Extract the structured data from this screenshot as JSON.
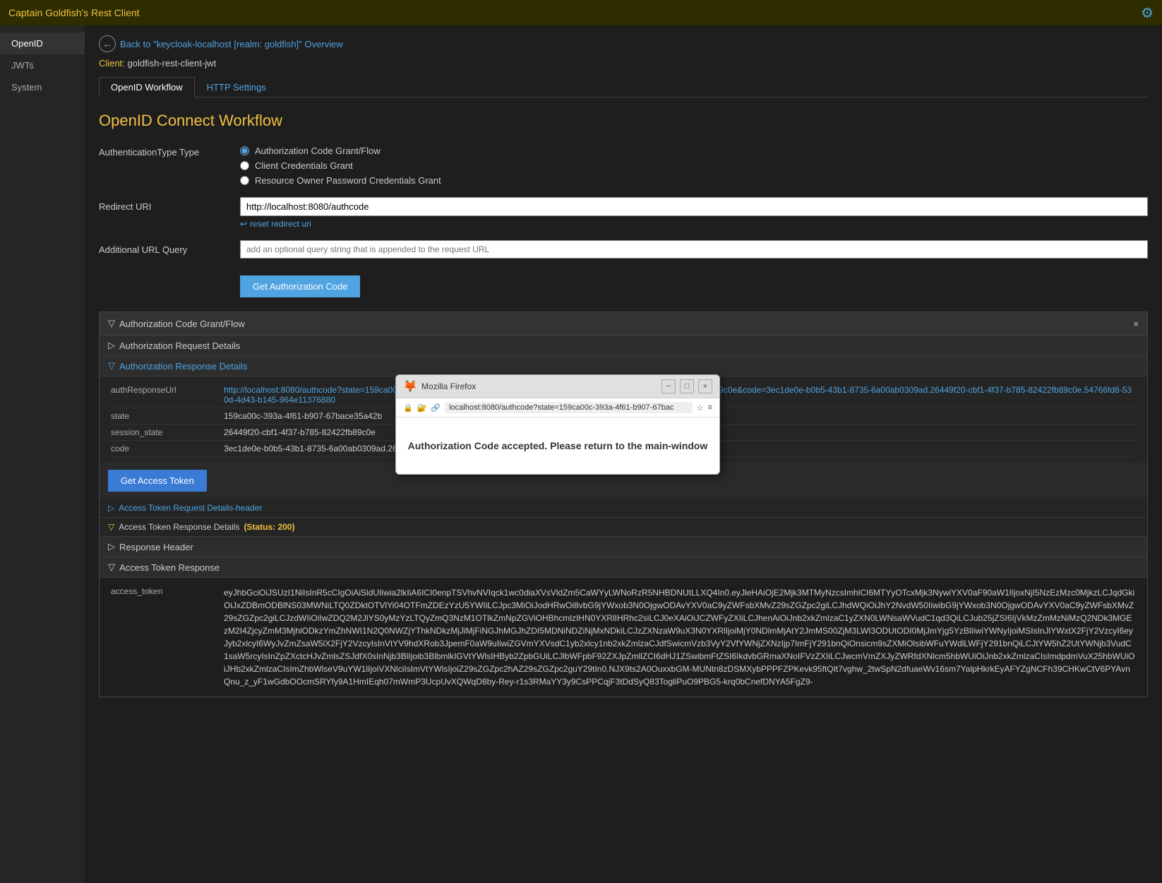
{
  "titlebar": {
    "title": "Captain Goldfish's Rest Client",
    "icon": "⚙"
  },
  "sidebar": {
    "items": [
      {
        "id": "openid",
        "label": "OpenID",
        "active": true
      },
      {
        "id": "jwts",
        "label": "JWTs",
        "active": false
      },
      {
        "id": "system",
        "label": "System",
        "active": false
      }
    ]
  },
  "header": {
    "back_text": "Back to \"keycloak-localhost [realm: goldfish]\" Overview",
    "client_label": "Client:",
    "client_value": "goldfish-rest-client-jwt"
  },
  "tabs": [
    {
      "id": "openid-workflow",
      "label": "OpenID Workflow",
      "active": true
    },
    {
      "id": "http-settings",
      "label": "HTTP Settings",
      "active": false
    }
  ],
  "workflow": {
    "title": "OpenID Connect Workflow",
    "auth_type_label": "AuthenticationType Type",
    "auth_types": [
      {
        "id": "auth-code",
        "label": "Authorization Code Grant/Flow",
        "checked": true
      },
      {
        "id": "client-cred",
        "label": "Client Credentials Grant",
        "checked": false
      },
      {
        "id": "resource-owner",
        "label": "Resource Owner Password Credentials Grant",
        "checked": false
      }
    ],
    "redirect_uri_label": "Redirect URI",
    "redirect_uri_value": "http://localhost:8080/authcode",
    "reset_link": "reset redirect uri",
    "additional_url_label": "Additional URL Query",
    "additional_url_placeholder": "add an optional query string that is appended to the request URL",
    "get_auth_code_btn": "Get Authorization Code"
  },
  "auth_code_section": {
    "title": "Authorization Code Grant/Flow",
    "request_details_label": "Authorization Request Details",
    "response_details_label": "Authorization Response Details",
    "response_fields": [
      {
        "key": "authResponseUrl",
        "value": "http://localhost:8080/authcode?state=159ca00c-393a-4f61-b907-67bace35a42b&session_state=26449f20-cbf1-4f37-b785-82422fb89c0e&code=3ec1de0e-b0b5-43b1-8735-6a00ab0309ad.26449f20-cbf1-4f37-b785-82422fb89c0e.54766fd8-530d-4d43-b145-964e11376880",
        "is_url": true
      },
      {
        "key": "state",
        "value": "159ca00c-393a-4f61-b907-67bace35a42b",
        "is_url": false
      },
      {
        "key": "session_state",
        "value": "26449f20-cbf1-4f37-b785-82422fb89c0e",
        "is_url": false
      },
      {
        "key": "code",
        "value": "3ec1de0e-b0b5-43b1-8735-6a00ab0309ad.26449f20-cbf1-4f37-b785-82422fb89c0e.54766fd8-530d-4d43-b145-964e11376880",
        "is_url": false
      }
    ]
  },
  "access_token_section": {
    "get_token_btn": "Get Access Token",
    "request_details_label": "Access Token Request Details-header",
    "response_details_label": "Access Token Response Details",
    "response_status": "(Status: 200)",
    "response_header_label": "Response Header",
    "access_token_response_label": "Access Token Response",
    "access_token_key": "access_token",
    "access_token_value": "eyJhbGciOiJSUzI1NiIsInR5cCIgOiAiSldUIiwia2lkIiA6ICI0enpTSVhvNVIqck1wc0diaXVsVldZm5CaWYyLWNoRzR5NHBDNUtLLXQ4In0.eyJleHAiOjE2Mjk3MTMyNzcsImhlCI6MTYyOTcxMjk3NywiYXV0aF90aW1lIjoxNjI5NzEzMzc0MjkzLCJqdGkiOiJxZDBmODBlNS03MWNiLTQ0ZDktOTVlYi04OTFmZDEzYzU5YWIiLCJpc3MiOiJodHRwOi8vbG9jYWxob3N0OjgwODAvYXV0aC9yZWFsbXMvZ29sZGZpc2giLCJhdWQiOiJhY2NvdW50IiwibG9jYWxob3N0OjgwODAvYXV0aC9yZWFsbXMvZ29sZGZpc2giLCJzdWIiOiIwZDQ2M2JlYS0yMzYzLTQyZmQ3NzM1OTlkZmNpZGViOHBhcmlzIHN0YXRlIHRhc2siLCJ0eXAiOiJCZWFyZXIiLCJhenAiOiJnb2xkZmlzaC1yZXN0LWNsaWVudC1qd3QiLCJub25jZSI6IjVkMzZmMzNiMzQ2NDk3MGEzM2I4ZjcyZmM3MjhlODkzYmZhNWI1N2Q0NWZjYThkNDkzMjJiMjFiNGJhMGJhZDI5MDNiNDZiNjMxNDkiLCJzZXNzaW9uX3N0YXRlIjoiMjY0NDlmMjAtY2JmMS00ZjM3LWI3ODUtODI0MjJmYjg5YzBlIiwiYWNyIjoiMSIsInJlYWxtX2FjY2VzcyI6eyJyb2xlcyI6WyJvZmZsaW5lX2FjY2VzcyIsInVtYV9hdXRob3JpemF0aW9uIiwiZGVmYXVsdC1yb2xlcy1nb2xkZmlzaCJdfSwicmVzb3VyY2VfYWNjZXNzIjp7ImFjY291bnQiOnsicm9sZXMiOlsibWFuYWdlLWFjY291bnQiLCJtYW5hZ2UtYWNjb3VudC1saW5rcyIsInZpZXctcHJvZmlsZSJdfX0sInNjb3BlIjoib3BlbmlkIGVtYWlsIHByb2ZpbGUiLCJlbWFpbF92ZXJpZmllZCI6dHJ1ZSwibmFtZSI6IkdvbGRmaXNoIFVzZXIiLCJwcmVmZXJyZWRfdXNlcm5hbWUiOiJnb2xkZmlzaCIsImdpdmVuX25hbWUiOiJHb2xkZmlzaCIsImZhbWlseV9uYW1lIjoiVXNlciIsImVtYWlsIjoiZ29sZGZpc2hAZ29sZGZpc2guY29tIn0.NJX9ts2A0OuxxbGM-MUNtn8zDSMXybPPPFZPKevk95ftQIt7vghw_2twSpN2dfuaeWv16sm7YalpHkrkEyAFYZgNCFh39CHKwCtV6PYAvnQnu_z_yF1wGdbOOcmSRYfy9A1HmIEqh07mWmP3UcpUvXQWqD8by-Rey-r1s3RMaYY3y9CsPPCqjF3tDdSyQ83TogliPuO9PBG5-krq0bCnefDNYA5FgZ9-"
  },
  "firefox_popup": {
    "title": "Mozilla Firefox",
    "url": "localhost:8080/authcode?state=159ca00c-393a-4f61-b907-67bac",
    "message": "Authorization Code accepted. Please return to the main-window",
    "btn_min": "−",
    "btn_max": "□",
    "btn_close": "×"
  },
  "colors": {
    "accent": "#f0c040",
    "link": "#4fa3e0",
    "bg_dark": "#1e1e1e",
    "bg_medium": "#252525",
    "btn_blue": "#4fa3e0"
  }
}
